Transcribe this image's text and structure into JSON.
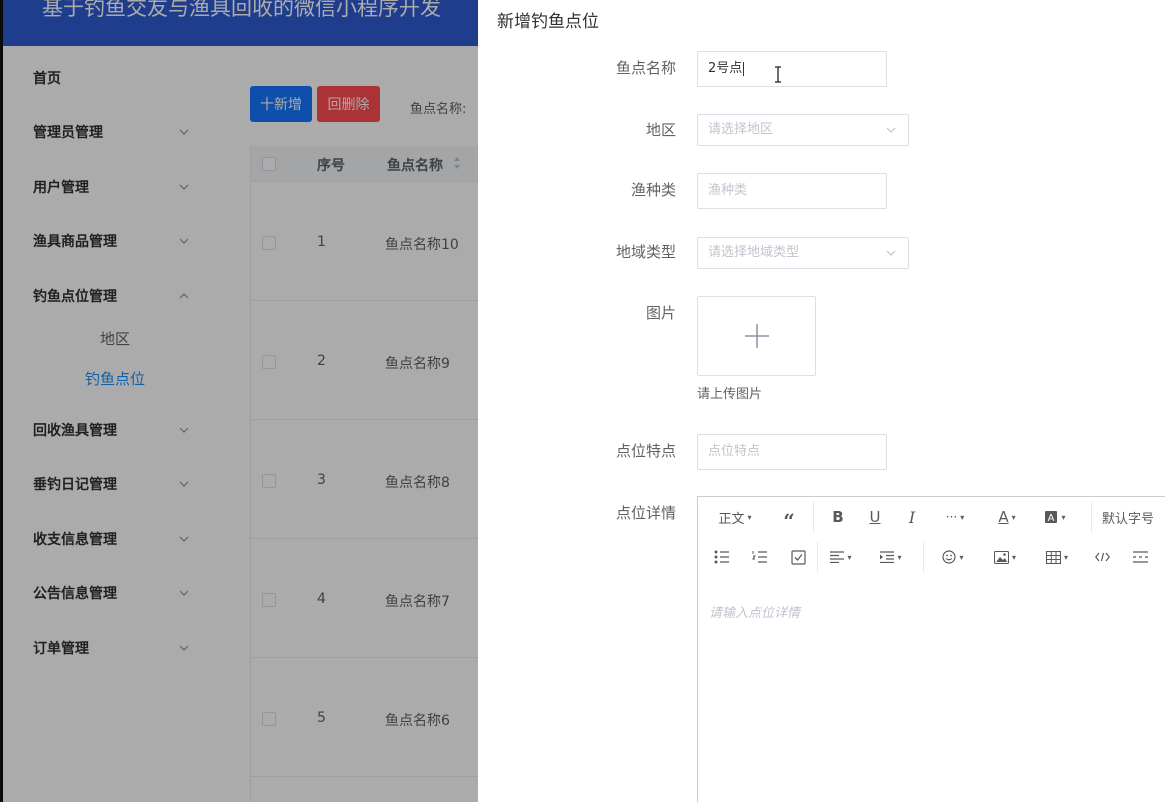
{
  "app": {
    "title": "基于钓鱼交友与渔具回收的微信小程序开发"
  },
  "sidebar": {
    "items": [
      {
        "label": "首页"
      },
      {
        "label": "管理员管理"
      },
      {
        "label": "用户管理"
      },
      {
        "label": "渔具商品管理"
      },
      {
        "label": "钓鱼点位管理"
      },
      {
        "label": "回收渔具管理"
      },
      {
        "label": "垂钓日记管理"
      },
      {
        "label": "收支信息管理"
      },
      {
        "label": "公告信息管理"
      },
      {
        "label": "订单管理"
      }
    ],
    "submenu": [
      {
        "label": "地区"
      },
      {
        "label": "钓鱼点位"
      }
    ]
  },
  "toolbar": {
    "add_label": "十新增",
    "delete_label": "回删除",
    "search_label": "鱼点名称:"
  },
  "table": {
    "headers": {
      "index": "序号",
      "name": "鱼点名称"
    },
    "rows": [
      {
        "index": "1",
        "name": "鱼点名称10"
      },
      {
        "index": "2",
        "name": "鱼点名称9"
      },
      {
        "index": "3",
        "name": "鱼点名称8"
      },
      {
        "index": "4",
        "name": "鱼点名称7"
      },
      {
        "index": "5",
        "name": "鱼点名称6"
      }
    ]
  },
  "drawer": {
    "title": "新增钓鱼点位",
    "fields": {
      "name_label": "鱼点名称",
      "name_value": "2号点",
      "region_label": "地区",
      "region_placeholder": "请选择地区",
      "fish_label": "渔种类",
      "fish_placeholder": "渔种类",
      "area_type_label": "地域类型",
      "area_type_placeholder": "请选择地域类型",
      "image_label": "图片",
      "image_tip": "请上传图片",
      "feature_label": "点位特点",
      "feature_placeholder": "点位特点",
      "detail_label": "点位详情",
      "detail_placeholder": "请输入点位详情"
    },
    "editor": {
      "heading_label": "正文",
      "font_size_label": "默认字号"
    }
  },
  "colors": {
    "header": "#2d5bd3",
    "primary": "#1677ff",
    "danger": "#ff4d4f",
    "active_menu": "#1890ff"
  }
}
